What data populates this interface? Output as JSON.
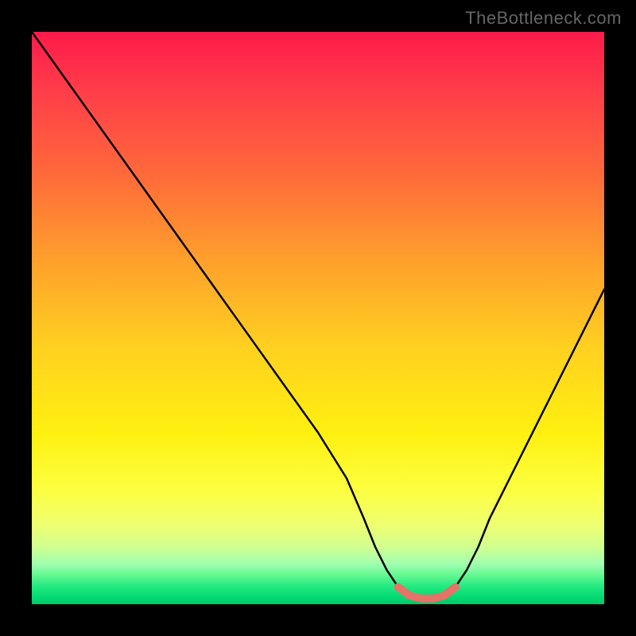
{
  "watermark": "TheBottleneck.com",
  "chart_data": {
    "type": "line",
    "title": "",
    "xlabel": "",
    "ylabel": "",
    "xlim": [
      0,
      100
    ],
    "ylim": [
      0,
      100
    ],
    "x": [
      0,
      5,
      10,
      15,
      20,
      25,
      30,
      35,
      40,
      45,
      50,
      55,
      58,
      60,
      62,
      64,
      66,
      68,
      70,
      72,
      74,
      76,
      78,
      80,
      85,
      90,
      95,
      100
    ],
    "values": [
      100,
      93,
      86,
      79,
      72,
      65,
      58,
      51,
      44,
      37,
      30,
      22,
      15,
      10,
      6,
      3,
      1.5,
      1,
      1,
      1.5,
      3,
      6,
      10,
      15,
      25,
      35,
      45,
      55
    ],
    "notes": "V-shaped bottleneck curve; minimum (optimal match) occurs around x≈65–72% with a short flat red segment at the trough; background gradient maps green (low y) through yellow/orange to red (high y)."
  },
  "colors": {
    "trough_segment": "#e57368",
    "curve": "#000000",
    "background_top": "#ff1a4a",
    "background_bottom": "#00c868",
    "frame": "#000000"
  }
}
